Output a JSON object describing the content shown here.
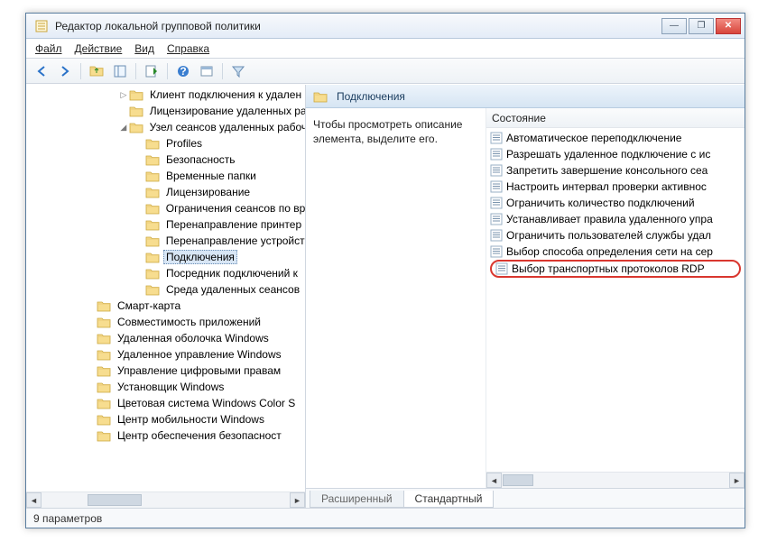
{
  "window": {
    "title": "Редактор локальной групповой политики"
  },
  "menubar": {
    "file": "Файл",
    "action": "Действие",
    "view": "Вид",
    "help": "Справка"
  },
  "tree": {
    "items": [
      {
        "indent": 102,
        "twisty": "▷",
        "label": "Клиент подключения к удален"
      },
      {
        "indent": 102,
        "twisty": "",
        "label": "Лицензирование удаленных ра"
      },
      {
        "indent": 102,
        "twisty": "◢",
        "label": "Узел сеансов удаленных рабоч"
      },
      {
        "indent": 120,
        "twisty": "",
        "label": "Profiles"
      },
      {
        "indent": 120,
        "twisty": "",
        "label": "Безопасность"
      },
      {
        "indent": 120,
        "twisty": "",
        "label": "Временные папки"
      },
      {
        "indent": 120,
        "twisty": "",
        "label": "Лицензирование"
      },
      {
        "indent": 120,
        "twisty": "",
        "label": "Ограничения сеансов по вр"
      },
      {
        "indent": 120,
        "twisty": "",
        "label": "Перенаправление принтер"
      },
      {
        "indent": 120,
        "twisty": "",
        "label": "Перенаправление устройст"
      },
      {
        "indent": 120,
        "twisty": "",
        "label": "Подключения",
        "selected": true
      },
      {
        "indent": 120,
        "twisty": "",
        "label": "Посредник подключений к"
      },
      {
        "indent": 120,
        "twisty": "",
        "label": "Среда удаленных сеансов"
      },
      {
        "indent": 66,
        "twisty": "",
        "label": "Смарт-карта"
      },
      {
        "indent": 66,
        "twisty": "",
        "label": "Совместимость приложений"
      },
      {
        "indent": 66,
        "twisty": "",
        "label": "Удаленная оболочка Windows"
      },
      {
        "indent": 66,
        "twisty": "",
        "label": "Удаленное управление Windows"
      },
      {
        "indent": 66,
        "twisty": "",
        "label": "Управление цифровыми правам"
      },
      {
        "indent": 66,
        "twisty": "",
        "label": "Установщик Windows"
      },
      {
        "indent": 66,
        "twisty": "",
        "label": "Цветовая система Windows Color S"
      },
      {
        "indent": 66,
        "twisty": "",
        "label": "Центр мобильности Windows"
      },
      {
        "indent": 66,
        "twisty": "",
        "label": "Центр обеспечения безопасност"
      }
    ]
  },
  "right": {
    "header": "Подключения",
    "description": "Чтобы просмотреть описание элемента, выделите его.",
    "column_header": "Состояние",
    "items": [
      {
        "label": "Автоматическое переподключение"
      },
      {
        "label": "Разрешать удаленное подключение с ис"
      },
      {
        "label": "Запретить завершение консольного сеа"
      },
      {
        "label": "Настроить интервал проверки активнос"
      },
      {
        "label": "Ограничить количество подключений"
      },
      {
        "label": "Устанавливает правила удаленного упра"
      },
      {
        "label": "Ограничить пользователей службы удал"
      },
      {
        "label": "Выбор способа определения сети на сер"
      },
      {
        "label": "Выбор транспортных протоколов RDP",
        "highlighted": true
      }
    ]
  },
  "tabs": {
    "extended": "Расширенный",
    "standard": "Стандартный"
  },
  "statusbar": {
    "text": "9 параметров"
  }
}
